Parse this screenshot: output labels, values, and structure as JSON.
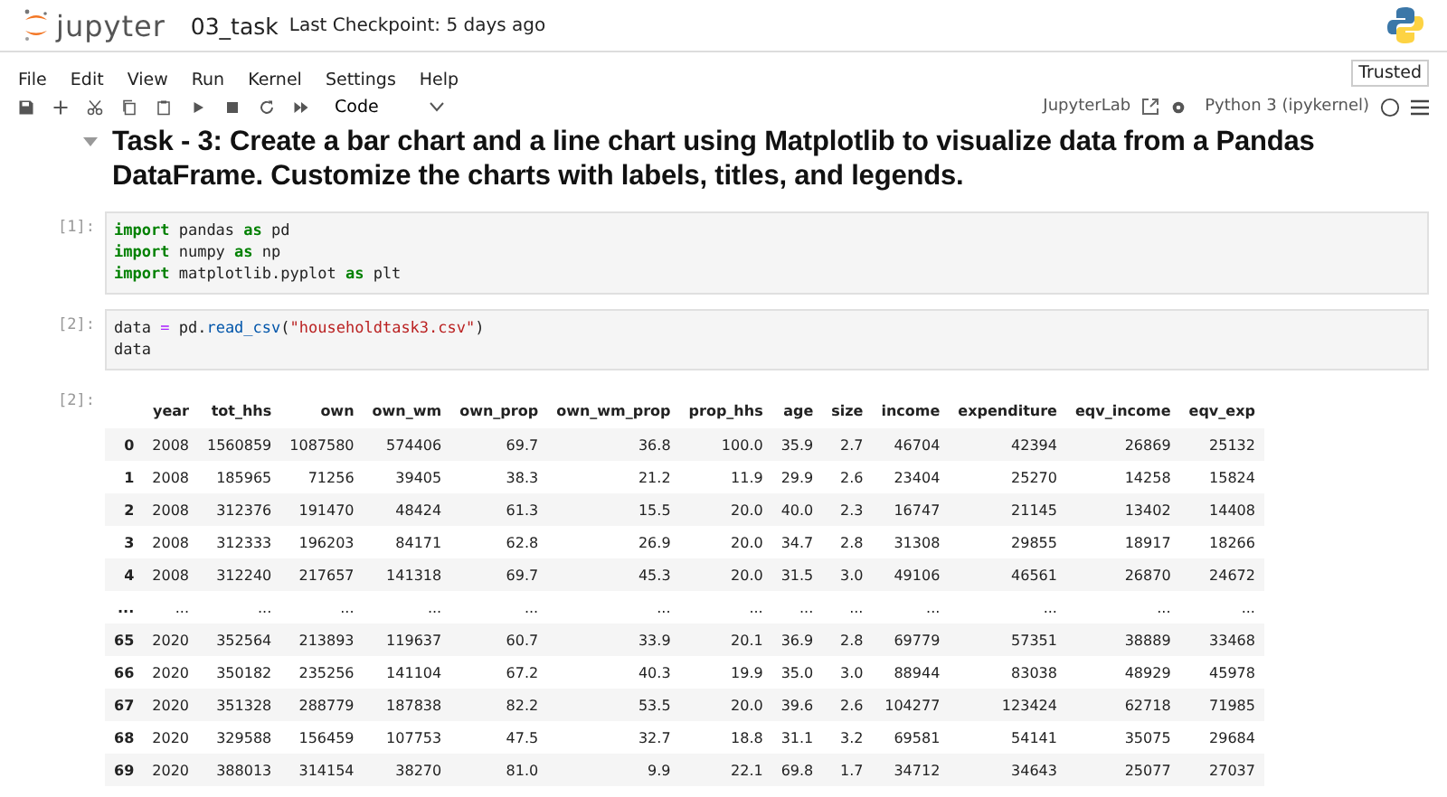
{
  "header": {
    "logo_text": "jupyter",
    "notebook_name": "03_task",
    "checkpoint": "Last Checkpoint: 5 days ago"
  },
  "menu": [
    {
      "label": "File"
    },
    {
      "label": "Edit"
    },
    {
      "label": "View"
    },
    {
      "label": "Run"
    },
    {
      "label": "Kernel"
    },
    {
      "label": "Settings"
    },
    {
      "label": "Help"
    }
  ],
  "trusted": "Trusted",
  "toolbar": {
    "buttons": [
      {
        "kind": "save"
      },
      {
        "kind": "add"
      },
      {
        "kind": "cut"
      },
      {
        "kind": "copy"
      },
      {
        "kind": "paste"
      },
      {
        "kind": "run"
      },
      {
        "kind": "stop"
      },
      {
        "kind": "restart"
      },
      {
        "kind": "run-all"
      }
    ],
    "cell_type": "Code",
    "jupyterlab": "JupyterLab",
    "kernel": "Python 3 (ipykernel)"
  },
  "heading": "Task - 3: Create a bar chart and a line chart using Matplotlib to visualize data from a Pandas DataFrame. Customize the charts with labels, titles, and legends.",
  "cells": [
    {
      "prompt": "[1]:",
      "lines": [
        [
          {
            "kind": "kw",
            "text": "import"
          },
          {
            "kind": "plain",
            "text": " pandas "
          },
          {
            "kind": "kw",
            "text": "as"
          },
          {
            "kind": "plain",
            "text": " pd"
          }
        ],
        [
          {
            "kind": "kw",
            "text": "import"
          },
          {
            "kind": "plain",
            "text": " numpy "
          },
          {
            "kind": "kw",
            "text": "as"
          },
          {
            "kind": "plain",
            "text": " np"
          }
        ],
        [
          {
            "kind": "kw",
            "text": "import"
          },
          {
            "kind": "plain",
            "text": " matplotlib.pyplot "
          },
          {
            "kind": "kw",
            "text": "as"
          },
          {
            "kind": "plain",
            "text": " plt"
          }
        ]
      ]
    },
    {
      "prompt": "[2]:",
      "lines": [
        [
          {
            "kind": "plain",
            "text": "data "
          },
          {
            "kind": "op",
            "text": "="
          },
          {
            "kind": "plain",
            "text": " pd."
          },
          {
            "kind": "func",
            "text": "read_csv"
          },
          {
            "kind": "plain",
            "text": "("
          },
          {
            "kind": "str",
            "text": "\"householdtask3.csv\""
          },
          {
            "kind": "plain",
            "text": ")"
          }
        ],
        [
          {
            "kind": "plain",
            "text": "data"
          }
        ]
      ]
    }
  ],
  "output": {
    "prompt": "[2]:",
    "columns": [
      "year",
      "tot_hhs",
      "own",
      "own_wm",
      "own_prop",
      "own_wm_prop",
      "prop_hhs",
      "age",
      "size",
      "income",
      "expenditure",
      "eqv_income",
      "eqv_exp"
    ],
    "rows": [
      {
        "index": "0",
        "cells": [
          "2008",
          "1560859",
          "1087580",
          "574406",
          "69.7",
          "36.8",
          "100.0",
          "35.9",
          "2.7",
          "46704",
          "42394",
          "26869",
          "25132"
        ]
      },
      {
        "index": "1",
        "cells": [
          "2008",
          "185965",
          "71256",
          "39405",
          "38.3",
          "21.2",
          "11.9",
          "29.9",
          "2.6",
          "23404",
          "25270",
          "14258",
          "15824"
        ]
      },
      {
        "index": "2",
        "cells": [
          "2008",
          "312376",
          "191470",
          "48424",
          "61.3",
          "15.5",
          "20.0",
          "40.0",
          "2.3",
          "16747",
          "21145",
          "13402",
          "14408"
        ]
      },
      {
        "index": "3",
        "cells": [
          "2008",
          "312333",
          "196203",
          "84171",
          "62.8",
          "26.9",
          "20.0",
          "34.7",
          "2.8",
          "31308",
          "29855",
          "18917",
          "18266"
        ]
      },
      {
        "index": "4",
        "cells": [
          "2008",
          "312240",
          "217657",
          "141318",
          "69.7",
          "45.3",
          "20.0",
          "31.5",
          "3.0",
          "49106",
          "46561",
          "26870",
          "24672"
        ]
      },
      {
        "index": "...",
        "cells": [
          "...",
          "...",
          "...",
          "...",
          "...",
          "...",
          "...",
          "...",
          "...",
          "...",
          "...",
          "...",
          "..."
        ]
      },
      {
        "index": "65",
        "cells": [
          "2020",
          "352564",
          "213893",
          "119637",
          "60.7",
          "33.9",
          "20.1",
          "36.9",
          "2.8",
          "69779",
          "57351",
          "38889",
          "33468"
        ]
      },
      {
        "index": "66",
        "cells": [
          "2020",
          "350182",
          "235256",
          "141104",
          "67.2",
          "40.3",
          "19.9",
          "35.0",
          "3.0",
          "88944",
          "83038",
          "48929",
          "45978"
        ]
      },
      {
        "index": "67",
        "cells": [
          "2020",
          "351328",
          "288779",
          "187838",
          "82.2",
          "53.5",
          "20.0",
          "39.6",
          "2.6",
          "104277",
          "123424",
          "62718",
          "71985"
        ]
      },
      {
        "index": "68",
        "cells": [
          "2020",
          "329588",
          "156459",
          "107753",
          "47.5",
          "32.7",
          "18.8",
          "31.1",
          "3.2",
          "69581",
          "54141",
          "35075",
          "29684"
        ]
      },
      {
        "index": "69",
        "cells": [
          "2020",
          "388013",
          "314154",
          "38270",
          "81.0",
          "9.9",
          "22.1",
          "69.8",
          "1.7",
          "34712",
          "34643",
          "25077",
          "27037"
        ]
      }
    ]
  }
}
